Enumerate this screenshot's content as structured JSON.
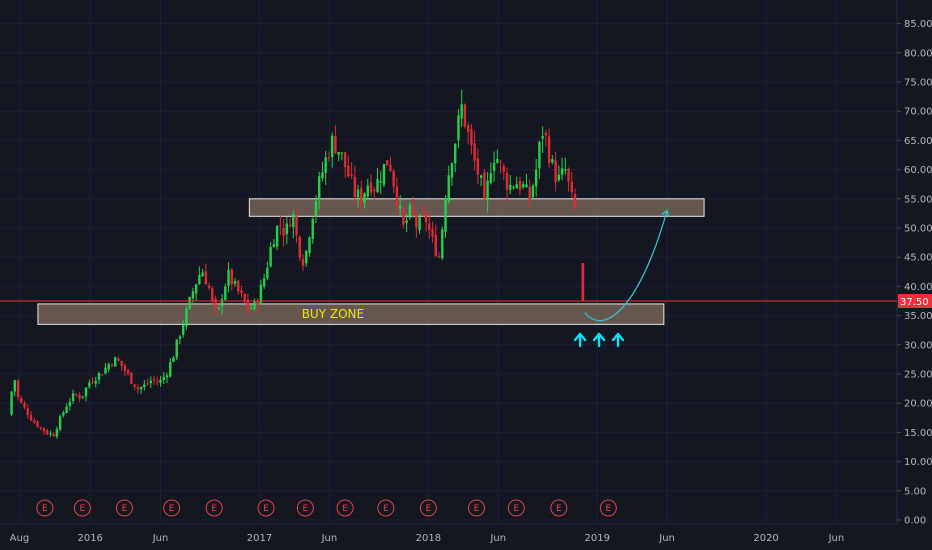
{
  "chart_data": {
    "type": "candlestick",
    "title": "",
    "xlabel": "",
    "ylabel": "",
    "ylim": [
      0,
      87.5
    ],
    "yticks": [
      0,
      5,
      10,
      15,
      20,
      25,
      30,
      35,
      40,
      45,
      50,
      55,
      60,
      65,
      70,
      75,
      80,
      85
    ],
    "ytick_labels": [
      "0.00",
      "5.00",
      "10.00",
      "15.00",
      "20.00",
      "25.00",
      "30.00",
      "35.00",
      "40.00",
      "45.00",
      "50.00",
      "55.00",
      "60.00",
      "65.00",
      "70.00",
      "75.00",
      "80.00",
      "85.00"
    ],
    "xlim": [
      "2015-06-20",
      "2020-10-10"
    ],
    "xticks": [
      {
        "date": "2015-08-01",
        "label": "Aug"
      },
      {
        "date": "2016-01-01",
        "label": "2016"
      },
      {
        "date": "2016-06-01",
        "label": "Jun"
      },
      {
        "date": "2017-01-01",
        "label": "2017"
      },
      {
        "date": "2017-06-01",
        "label": "Jun"
      },
      {
        "date": "2018-01-01",
        "label": "2018"
      },
      {
        "date": "2018-06-01",
        "label": "Jun"
      },
      {
        "date": "2019-01-01",
        "label": "2019"
      },
      {
        "date": "2019-06-01",
        "label": "Jun"
      },
      {
        "date": "2020-01-01",
        "label": "2020"
      },
      {
        "date": "2020-06-01",
        "label": "Jun"
      }
    ],
    "current_price": 37.5,
    "current_price_label": "37.50",
    "price_path": [
      [
        "2015-07-15",
        18
      ],
      [
        "2015-07-22",
        22
      ],
      [
        "2015-07-29",
        24
      ],
      [
        "2015-08-05",
        21
      ],
      [
        "2015-08-15",
        19.5
      ],
      [
        "2015-08-25",
        18.5
      ],
      [
        "2015-09-05",
        17
      ],
      [
        "2015-09-20",
        16
      ],
      [
        "2015-10-05",
        15
      ],
      [
        "2015-10-20",
        14.5
      ],
      [
        "2015-11-05",
        17.5
      ],
      [
        "2015-11-20",
        20
      ],
      [
        "2015-12-05",
        21.5
      ],
      [
        "2015-12-20",
        21
      ],
      [
        "2016-01-05",
        23.5
      ],
      [
        "2016-01-20",
        24.5
      ],
      [
        "2016-02-05",
        25.5
      ],
      [
        "2016-02-20",
        27
      ],
      [
        "2016-03-05",
        27.5
      ],
      [
        "2016-03-20",
        26
      ],
      [
        "2016-04-05",
        24
      ],
      [
        "2016-04-20",
        22.5
      ],
      [
        "2016-05-05",
        23
      ],
      [
        "2016-05-20",
        24
      ],
      [
        "2016-06-05",
        23.5
      ],
      [
        "2016-06-20",
        25
      ],
      [
        "2016-07-05",
        28
      ],
      [
        "2016-07-20",
        32
      ],
      [
        "2016-08-05",
        36
      ],
      [
        "2016-08-20",
        40
      ],
      [
        "2016-09-05",
        43
      ],
      [
        "2016-09-20",
        40
      ],
      [
        "2016-10-01",
        36
      ],
      [
        "2016-10-10",
        35
      ],
      [
        "2016-10-20",
        39
      ],
      [
        "2016-11-01",
        42
      ],
      [
        "2016-11-15",
        40
      ],
      [
        "2016-12-01",
        38
      ],
      [
        "2016-12-15",
        36
      ],
      [
        "2017-01-01",
        37
      ],
      [
        "2017-01-20",
        42
      ],
      [
        "2017-02-05",
        48
      ],
      [
        "2017-02-20",
        51
      ],
      [
        "2017-03-05",
        49
      ],
      [
        "2017-03-20",
        53
      ],
      [
        "2017-04-01",
        47
      ],
      [
        "2017-04-15",
        44
      ],
      [
        "2017-05-01",
        52
      ],
      [
        "2017-05-15",
        57
      ],
      [
        "2017-06-01",
        62
      ],
      [
        "2017-06-15",
        65
      ],
      [
        "2017-07-01",
        63
      ],
      [
        "2017-07-15",
        60
      ],
      [
        "2017-08-01",
        56
      ],
      [
        "2017-08-15",
        55
      ],
      [
        "2017-09-01",
        58
      ],
      [
        "2017-09-15",
        57
      ],
      [
        "2017-10-01",
        60
      ],
      [
        "2017-10-15",
        62
      ],
      [
        "2017-11-01",
        55
      ],
      [
        "2017-11-15",
        50
      ],
      [
        "2017-12-01",
        53
      ],
      [
        "2017-12-15",
        50
      ],
      [
        "2018-01-01",
        52
      ],
      [
        "2018-01-15",
        48
      ],
      [
        "2018-02-01",
        45
      ],
      [
        "2018-02-15",
        57
      ],
      [
        "2018-03-01",
        63
      ],
      [
        "2018-03-10",
        66
      ],
      [
        "2018-03-20",
        71
      ],
      [
        "2018-04-01",
        67
      ],
      [
        "2018-04-15",
        62
      ],
      [
        "2018-05-01",
        58
      ],
      [
        "2018-05-10",
        53
      ],
      [
        "2018-05-20",
        60
      ],
      [
        "2018-06-01",
        63
      ],
      [
        "2018-06-15",
        60
      ],
      [
        "2018-07-01",
        57
      ],
      [
        "2018-07-15",
        58
      ],
      [
        "2018-08-01",
        57
      ],
      [
        "2018-08-15",
        55
      ],
      [
        "2018-09-01",
        61
      ],
      [
        "2018-09-10",
        67
      ],
      [
        "2018-09-20",
        65
      ],
      [
        "2018-10-01",
        61
      ],
      [
        "2018-10-15",
        58
      ],
      [
        "2018-11-01",
        60
      ],
      [
        "2018-11-10",
        56
      ],
      [
        "2018-11-20",
        53
      ]
    ],
    "last_candle": {
      "date": "2018-12-01",
      "open": 44,
      "high": 44,
      "low": 37.5,
      "close": 37.5
    },
    "annotations": [
      {
        "type": "zone",
        "name": "upper-resistance-zone",
        "x_start": "2016-12-10",
        "x_end": "2019-08-20",
        "y_low": 52,
        "y_high": 55,
        "label": ""
      },
      {
        "type": "zone",
        "name": "buy-zone",
        "x_start": "2015-09-10",
        "x_end": "2019-05-25",
        "y_low": 33.5,
        "y_high": 37,
        "label": "BUY ZONE"
      },
      {
        "type": "hline",
        "name": "current-price-line",
        "y": 37.5,
        "color": "#ef2f3a"
      },
      {
        "type": "arrow-curve",
        "name": "projected-path-arrow",
        "color": "#37c6ce",
        "points": [
          [
            "2018-12-05",
            35.5
          ],
          [
            "2019-01-15",
            31.5
          ],
          [
            "2019-04-01",
            36
          ],
          [
            "2019-06-01",
            53
          ]
        ]
      },
      {
        "type": "up-arrows",
        "name": "buy-arrows",
        "color": "#00e5ff",
        "dates": [
          "2018-11-25",
          "2019-01-05",
          "2019-02-15"
        ],
        "y": 31
      }
    ],
    "earnings_marker_label": "E",
    "earnings_dates": [
      "2015-09-25",
      "2015-12-15",
      "2016-03-15",
      "2016-06-25",
      "2016-09-25",
      "2017-01-15",
      "2017-04-10",
      "2017-07-05",
      "2017-10-01",
      "2018-01-01",
      "2018-04-15",
      "2018-07-10",
      "2018-10-10",
      "2019-01-25"
    ],
    "colors": {
      "background": "#131722",
      "up": "#26d04b",
      "down": "#e02b35",
      "zone_fill": "#84725f",
      "zone_stroke": "#e8e8e8",
      "grid": "#1e2230",
      "axis_text": "#b2b5be",
      "price_line": "#ef2f3a",
      "price_tag": "#ef2f3a",
      "zone_label": "#f5e400",
      "earnings": "#e0434e"
    }
  }
}
